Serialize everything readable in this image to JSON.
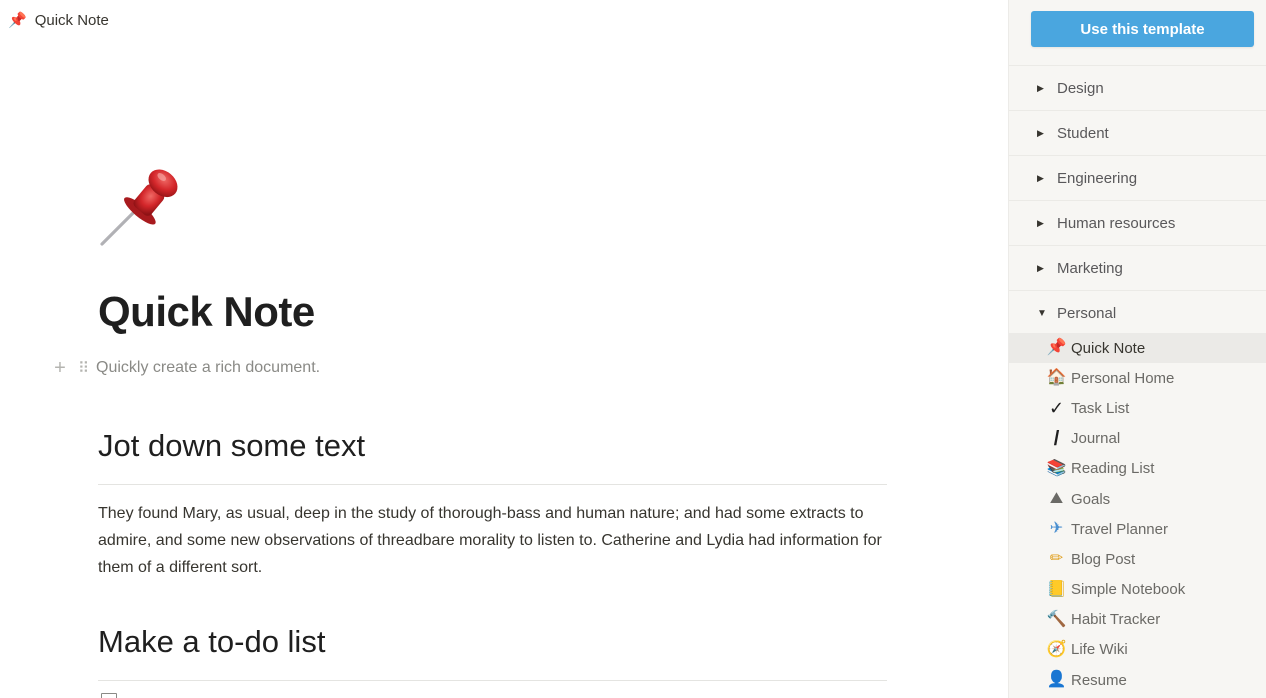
{
  "breadcrumb": {
    "icon": "pushpin-icon",
    "glyph": "📌",
    "label": "Quick Note"
  },
  "page": {
    "icon": "pushpin-icon",
    "title": "Quick Note",
    "subtitle": "Quickly create a rich document.",
    "sections": [
      {
        "heading": "Jot down some text",
        "body": "They found Mary, as usual, deep in the study of thorough-bass and human nature; and had some extracts to admire, and some new observations of threadbare morality to listen to. Catherine and Lydia had information for them of a different sort."
      },
      {
        "heading": "Make a to-do list"
      }
    ]
  },
  "sidebar": {
    "use_button": "Use this template",
    "accent_color": "#4aa6df",
    "categories": [
      {
        "label": "Design",
        "expanded": false
      },
      {
        "label": "Student",
        "expanded": false
      },
      {
        "label": "Engineering",
        "expanded": false
      },
      {
        "label": "Human resources",
        "expanded": false
      },
      {
        "label": "Marketing",
        "expanded": false
      },
      {
        "label": "Personal",
        "expanded": true
      }
    ],
    "templates": [
      {
        "label": "Quick Note",
        "icon": "pushpin-icon",
        "glyph": "📌",
        "active": true
      },
      {
        "label": "Personal Home",
        "icon": "house-icon",
        "glyph": "🏠"
      },
      {
        "label": "Task List",
        "icon": "checkmark-icon",
        "glyph": "✓"
      },
      {
        "label": "Journal",
        "icon": "pen-icon",
        "glyph": "/"
      },
      {
        "label": "Reading List",
        "icon": "books-icon",
        "glyph": "📚"
      },
      {
        "label": "Goals",
        "icon": "mountain-icon",
        "glyph": "⛰"
      },
      {
        "label": "Travel Planner",
        "icon": "airplane-icon",
        "glyph": "✈"
      },
      {
        "label": "Blog Post",
        "icon": "pencil-icon",
        "glyph": "✏"
      },
      {
        "label": "Simple Notebook",
        "icon": "notebook-icon",
        "glyph": "📒"
      },
      {
        "label": "Habit Tracker",
        "icon": "hammer-icon",
        "glyph": "🔨"
      },
      {
        "label": "Life Wiki",
        "icon": "compass-icon",
        "glyph": "🧭"
      },
      {
        "label": "Resume",
        "icon": "person-icon",
        "glyph": "👤"
      }
    ]
  }
}
